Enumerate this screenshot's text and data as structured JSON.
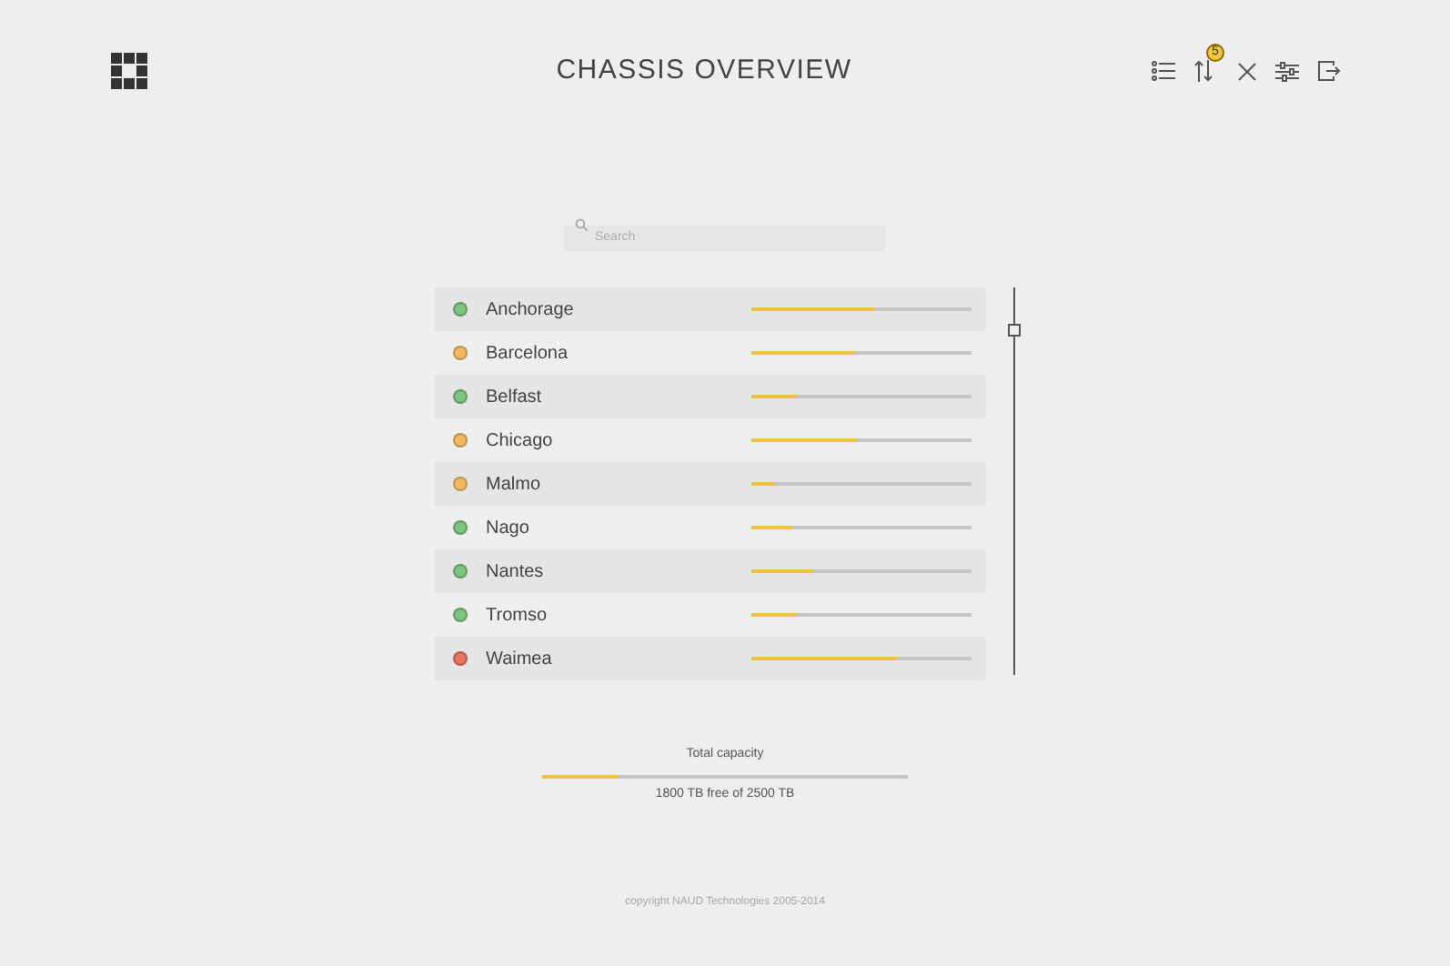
{
  "header": {
    "title": "CHASSIS OVERVIEW",
    "sort_badge": "5"
  },
  "search": {
    "placeholder": "Search"
  },
  "locations": [
    {
      "name": "Anchorage",
      "color": "#7cc47f",
      "level": 0.56
    },
    {
      "name": "Barcelona",
      "color": "#f0b860",
      "level": 0.47
    },
    {
      "name": "Belfast",
      "color": "#7cc47f",
      "level": 0.21
    },
    {
      "name": "Chicago",
      "color": "#f0b860",
      "level": 0.48
    },
    {
      "name": "Malmo",
      "color": "#f0b860",
      "level": 0.11
    },
    {
      "name": "Nago",
      "color": "#7cc47f",
      "level": 0.19
    },
    {
      "name": "Nantes",
      "color": "#7cc47f",
      "level": 0.28
    },
    {
      "name": "Tromso",
      "color": "#7cc47f",
      "level": 0.21
    },
    {
      "name": "Waimea",
      "color": "#e8735f",
      "level": 0.66
    }
  ],
  "total": {
    "label": "Total capacity",
    "level": 0.21,
    "reading": "1800 TB free of 2500 TB"
  },
  "footer": {
    "copyright": "copyright NAUD Technologies 2005-2014"
  }
}
